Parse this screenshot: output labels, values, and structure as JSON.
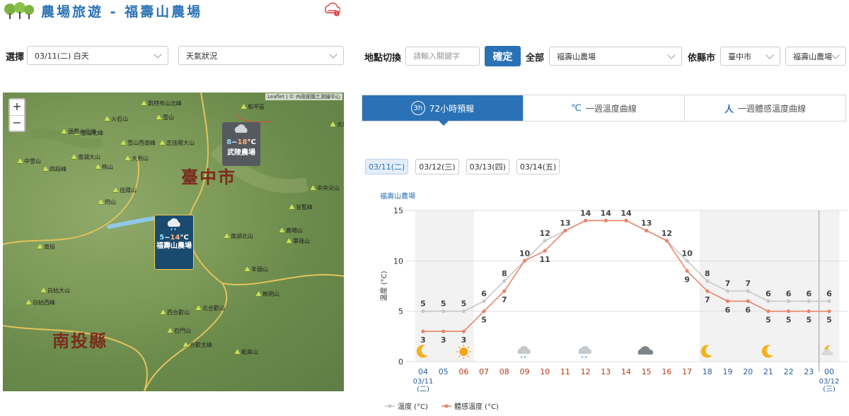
{
  "header": {
    "title": "農場旅遊 - 福壽山農場"
  },
  "filter": {
    "select_label": "選擇",
    "date_value": "03/11(二) 白天",
    "type_value": "天氣狀況"
  },
  "location": {
    "switch_label": "地點切換",
    "search_placeholder": "請輸入關鍵字",
    "confirm_label": "確定",
    "all_label": "全部",
    "all_value": "福壽山農場",
    "county_label": "依縣市",
    "county_value": "臺中市",
    "farm_value": "福壽山農場"
  },
  "map": {
    "attribution": "Leaflet | © 內政部國土測繪中心",
    "zoom_in": "+",
    "zoom_out": "−",
    "counties": [
      "臺中市",
      "南投縣"
    ],
    "stations": [
      {
        "temp_low": "8",
        "temp_sep": "~",
        "temp_high": "18",
        "unit": "°C",
        "name": "武陵農場"
      },
      {
        "temp_low": "5",
        "temp_sep": "~",
        "temp_high": "14",
        "unit": "°C",
        "name": "福壽山農場"
      }
    ],
    "peaks": [
      "凱特布山北峰",
      "雪山",
      "火石山",
      "和平區",
      "雪山北峰",
      "雪山西南峰",
      "志佳陽大山",
      "大霸尖山",
      "頭鷹山北峰",
      "中雪山",
      "南湖大山",
      "四段峰",
      "桃山",
      "大劍山",
      "閂山",
      "佳陽山",
      "中央尖山",
      "甘藍峰",
      "鹿場山",
      "畢祿山",
      "南湖北山",
      "南投",
      "白姑大山",
      "白姑西峰",
      "北合歡山",
      "西合歡山",
      "合歡主峰",
      "石門山",
      "羊頭山",
      "無明山",
      "能高山"
    ]
  },
  "tabs": [
    {
      "icon": "3h",
      "label": "72小時預報"
    },
    {
      "icon": "℃",
      "label": "一週溫度曲線"
    },
    {
      "icon": "人",
      "label": "一週體感溫度曲線"
    }
  ],
  "days": [
    "03/11(二)",
    "03/12(三)",
    "03/13(四)",
    "03/14(五)"
  ],
  "chart_title": "福壽山農場",
  "legend": {
    "temp": "溫度 (°C)",
    "apparent": "體感溫度 (°C)"
  },
  "colors": {
    "accent": "#2a72b5",
    "temp_line": "#c8c8c8",
    "apparent_line": "#e8846a",
    "night_band": "#f2f2f2"
  },
  "chart_data": {
    "type": "line",
    "ylabel": "溫度 (°C)",
    "ylim": [
      0,
      15
    ],
    "yticks": [
      0,
      5,
      10,
      15
    ],
    "x": [
      "04",
      "05",
      "06",
      "07",
      "08",
      "09",
      "10",
      "11",
      "12",
      "13",
      "14",
      "15",
      "16",
      "17",
      "18",
      "19",
      "20",
      "21",
      "22",
      "23",
      "00"
    ],
    "date_labels": [
      {
        "x": "04",
        "date": "03/11",
        "weekday": "(二)"
      },
      {
        "x": "00",
        "date": "03/12",
        "weekday": "(三)"
      }
    ],
    "series": [
      {
        "name": "溫度 (°C)",
        "values": [
          5,
          5,
          5,
          6,
          8,
          10,
          12,
          13,
          14,
          14,
          14,
          13,
          12,
          10,
          8,
          7,
          7,
          6,
          6,
          6,
          6
        ]
      },
      {
        "name": "體感溫度 (°C)",
        "values": [
          3,
          3,
          3,
          5,
          7,
          10,
          11,
          13,
          14,
          14,
          14,
          13,
          12,
          9,
          7,
          6,
          6,
          5,
          5,
          5,
          5
        ]
      }
    ],
    "weather_icons": [
      {
        "x": "04",
        "icon": "moon-icon"
      },
      {
        "x": "06",
        "icon": "sun-icon"
      },
      {
        "x": "09",
        "icon": "cloud-rain-icon"
      },
      {
        "x": "12",
        "icon": "cloud-rain-icon"
      },
      {
        "x": "15",
        "icon": "cloud-icon"
      },
      {
        "x": "18",
        "icon": "moon-icon"
      },
      {
        "x": "21",
        "icon": "moon-icon"
      },
      {
        "x": "00",
        "icon": "moon-cloud-icon"
      }
    ],
    "night_bands": [
      [
        "04",
        "06"
      ],
      [
        "18",
        "00"
      ]
    ]
  }
}
